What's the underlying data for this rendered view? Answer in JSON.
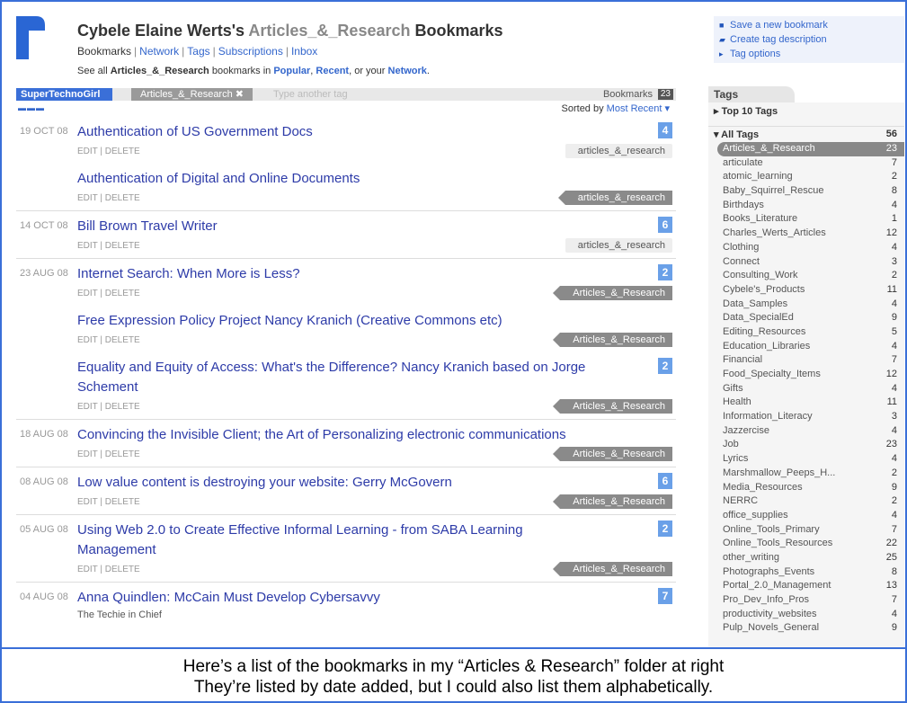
{
  "header": {
    "owner": "Cybele Elaine Werts's",
    "folder": "Articles_&_Research",
    "suffix": "Bookmarks",
    "nav": {
      "bookmarks": "Bookmarks",
      "network": "Network",
      "tags": "Tags",
      "subscriptions": "Subscriptions",
      "inbox": "Inbox"
    },
    "see_all": {
      "prefix": "See all",
      "tag": "Articles_&_Research",
      "mid": "bookmarks in",
      "popular": "Popular",
      "recent": "Recent",
      "or": ", or your",
      "network": "Network",
      "comma": ",",
      "end": "."
    }
  },
  "tagbar": {
    "user": "SuperTechnoGirl",
    "tag": "Articles_&_Research",
    "placeholder": "Type another tag",
    "bookmarks_label": "Bookmarks",
    "bookmarks_count": "23"
  },
  "sort": {
    "label": "Sorted by",
    "value": "Most Recent ▾"
  },
  "bookmarks": [
    {
      "date": "19 OCT 08",
      "title": "Authentication of US Government Docs",
      "edit": "EDIT",
      "delete": "DELETE",
      "tag": "articles_&_research",
      "count": "4"
    },
    {
      "date": "",
      "title": "Authentication of Digital and Online Documents",
      "edit": "EDIT",
      "delete": "DELETE",
      "tag": "articles_&_research",
      "count": ""
    },
    {
      "date": "14 OCT 08",
      "title": "Bill Brown Travel Writer",
      "edit": "EDIT",
      "delete": "DELETE",
      "tag": "articles_&_research",
      "count": "6"
    },
    {
      "date": "23 AUG 08",
      "title": "Internet Search: When More is Less?",
      "edit": "EDIT",
      "delete": "DELETE",
      "tag": "Articles_&_Research",
      "count": "2"
    },
    {
      "date": "",
      "title": "Free Expression Policy Project Nancy Kranich (Creative Commons etc)",
      "edit": "EDIT",
      "delete": "DELETE",
      "tag": "Articles_&_Research",
      "count": ""
    },
    {
      "date": "",
      "title": "Equality and Equity of Access: What's the Difference? Nancy Kranich based on Jorge Schement",
      "edit": "EDIT",
      "delete": "DELETE",
      "tag": "Articles_&_Research",
      "count": "2"
    },
    {
      "date": "18 AUG 08",
      "title": "Convincing the Invisible Client; the Art of Personalizing electronic communications",
      "edit": "EDIT",
      "delete": "DELETE",
      "tag": "Articles_&_Research",
      "count": ""
    },
    {
      "date": "08 AUG 08",
      "title": "Low value content is destroying your website: Gerry McGovern",
      "edit": "EDIT",
      "delete": "DELETE",
      "tag": "Articles_&_Research",
      "count": "6"
    },
    {
      "date": "05 AUG 08",
      "title": "Using Web 2.0 to Create Effective Informal Learning - from SABA Learning Management",
      "edit": "EDIT",
      "delete": "DELETE",
      "tag": "Articles_&_Research",
      "count": "2"
    },
    {
      "date": "04 AUG 08",
      "title": "Anna Quindlen: McCain Must Develop Cybersavvy",
      "subtitle": "The Techie in Chief",
      "count": "7"
    }
  ],
  "actions": {
    "save": "Save a new bookmark",
    "describe": "Create tag description",
    "options": "Tag options"
  },
  "tags": {
    "tab": "Tags",
    "top10": "▸ Top 10 Tags",
    "all_label": "▾ All Tags",
    "all_count": "56",
    "items": [
      {
        "name": "Articles_&_Research",
        "count": "23",
        "selected": true
      },
      {
        "name": "articulate",
        "count": "7"
      },
      {
        "name": "atomic_learning",
        "count": "2"
      },
      {
        "name": "Baby_Squirrel_Rescue",
        "count": "8"
      },
      {
        "name": "Birthdays",
        "count": "4"
      },
      {
        "name": "Books_Literature",
        "count": "1"
      },
      {
        "name": "Charles_Werts_Articles",
        "count": "12"
      },
      {
        "name": "Clothing",
        "count": "4"
      },
      {
        "name": "Connect",
        "count": "3"
      },
      {
        "name": "Consulting_Work",
        "count": "2"
      },
      {
        "name": "Cybele's_Products",
        "count": "11"
      },
      {
        "name": "Data_Samples",
        "count": "4"
      },
      {
        "name": "Data_SpecialEd",
        "count": "9"
      },
      {
        "name": "Editing_Resources",
        "count": "5"
      },
      {
        "name": "Education_Libraries",
        "count": "4"
      },
      {
        "name": "Financial",
        "count": "7"
      },
      {
        "name": "Food_Specialty_Items",
        "count": "12"
      },
      {
        "name": "Gifts",
        "count": "4"
      },
      {
        "name": "Health",
        "count": "11"
      },
      {
        "name": "Information_Literacy",
        "count": "3"
      },
      {
        "name": "Jazzercise",
        "count": "4"
      },
      {
        "name": "Job",
        "count": "23"
      },
      {
        "name": "Lyrics",
        "count": "4"
      },
      {
        "name": "Marshmallow_Peeps_H...",
        "count": "2"
      },
      {
        "name": "Media_Resources",
        "count": "9"
      },
      {
        "name": "NERRC",
        "count": "2"
      },
      {
        "name": "office_supplies",
        "count": "4"
      },
      {
        "name": "Online_Tools_Primary",
        "count": "7"
      },
      {
        "name": "Online_Tools_Resources",
        "count": "22"
      },
      {
        "name": "other_writing",
        "count": "25"
      },
      {
        "name": "Photographs_Events",
        "count": "8"
      },
      {
        "name": "Portal_2.0_Management",
        "count": "13"
      },
      {
        "name": "Pro_Dev_Info_Pros",
        "count": "7"
      },
      {
        "name": "productivity_websites",
        "count": "4"
      },
      {
        "name": "Pulp_Novels_General",
        "count": "9"
      }
    ]
  },
  "caption": {
    "line1": "Here’s a list of the bookmarks in my “Articles & Research” folder at right",
    "line2": "They’re listed by date added, but I could also list them alphabetically."
  },
  "colors": {
    "accent": "#3a6fd8",
    "link": "#3366cc",
    "title_link": "#2d3ba8",
    "count_badge": "#6aa0e8",
    "tag_dark": "#8a8a8a"
  }
}
